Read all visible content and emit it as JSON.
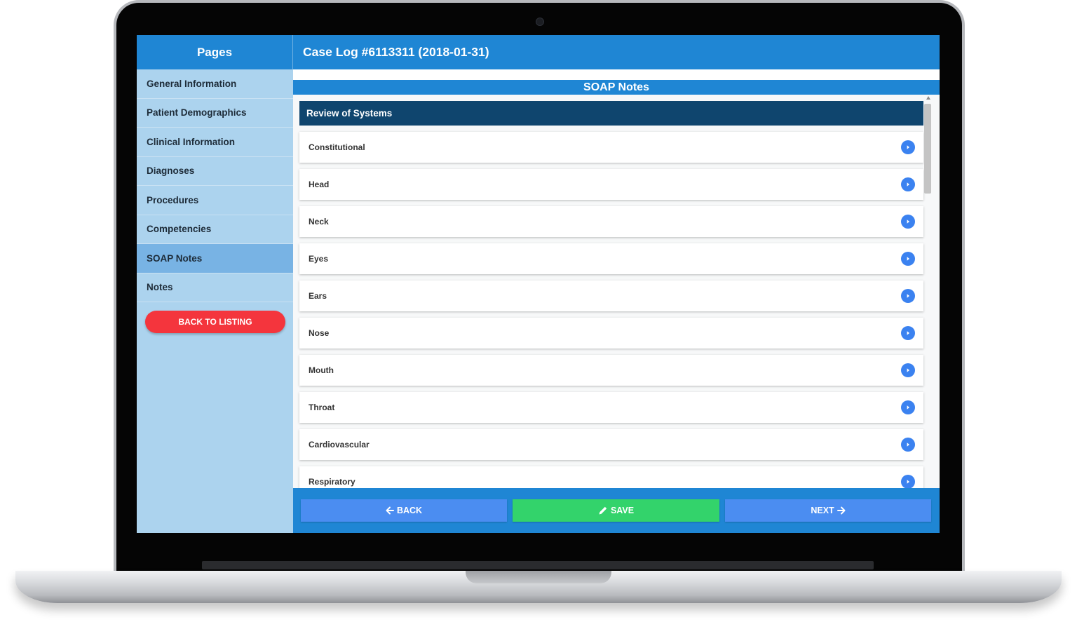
{
  "sidebar": {
    "title": "Pages",
    "items": [
      {
        "label": "General Information"
      },
      {
        "label": "Patient Demographics"
      },
      {
        "label": "Clinical Information"
      },
      {
        "label": "Diagnoses"
      },
      {
        "label": "Procedures"
      },
      {
        "label": "Competencies"
      },
      {
        "label": "SOAP Notes",
        "active": true
      },
      {
        "label": "Notes"
      }
    ],
    "back_button": "BACK TO LISTING"
  },
  "header": {
    "title": "Case Log #6113311 (2018-01-31)"
  },
  "section": {
    "title": "SOAP Notes"
  },
  "review": {
    "title": "Review of Systems",
    "items": [
      {
        "label": "Constitutional"
      },
      {
        "label": "Head"
      },
      {
        "label": "Neck"
      },
      {
        "label": "Eyes"
      },
      {
        "label": "Ears"
      },
      {
        "label": "Nose"
      },
      {
        "label": "Mouth"
      },
      {
        "label": "Throat"
      },
      {
        "label": "Cardiovascular"
      },
      {
        "label": "Respiratory"
      }
    ]
  },
  "footer": {
    "back_label": "BACK",
    "save_label": "SAVE",
    "next_label": "NEXT"
  },
  "colors": {
    "primary": "#1f86d4",
    "dark_header": "#0f456e",
    "danger": "#f4353d",
    "success": "#33d36b",
    "button_blue": "#4b8df1"
  },
  "icons": {
    "row_action": "chevron-right-circle-icon",
    "back": "arrow-left-icon",
    "save": "pencil-icon",
    "next": "arrow-right-icon"
  }
}
